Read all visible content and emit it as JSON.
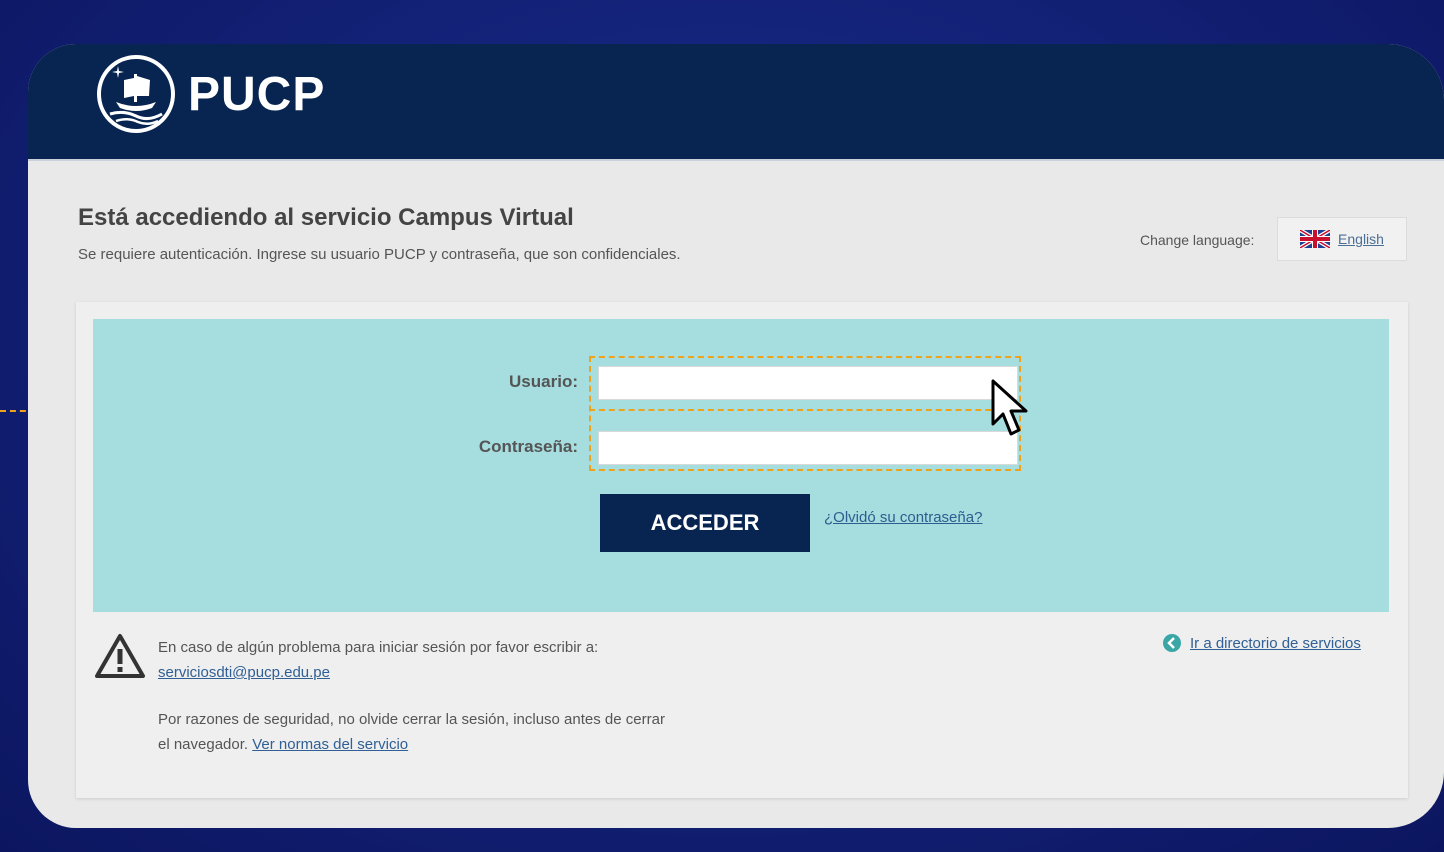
{
  "header": {
    "brand": "PUCP"
  },
  "page": {
    "title": "Está accediendo al servicio Campus Virtual",
    "subtitle": "Se requiere autenticación. Ingrese su usuario PUCP y contraseña, que son confidenciales."
  },
  "language": {
    "label": "Change language:",
    "option": "English"
  },
  "form": {
    "username_label": "Usuario:",
    "username_value": "",
    "password_label": "Contraseña:",
    "password_value": "",
    "submit_label": "ACCEDER",
    "forgot_label": "¿Olvidó su contraseña?"
  },
  "help": {
    "problem_text": "En caso de algún problema para iniciar sesión por favor escribir a:",
    "email": "serviciosdti@pucp.edu.pe",
    "security_text": "Por razones de seguridad, no olvide cerrar la sesión, incluso antes de cerrar el navegador.",
    "rules_link": "Ver normas del servicio",
    "directory_link": "Ir a directorio de servicios"
  },
  "colors": {
    "header_bg": "#072550",
    "form_bg": "#a6dedf",
    "highlight": "#f0a21a",
    "link": "#2f5f94"
  }
}
